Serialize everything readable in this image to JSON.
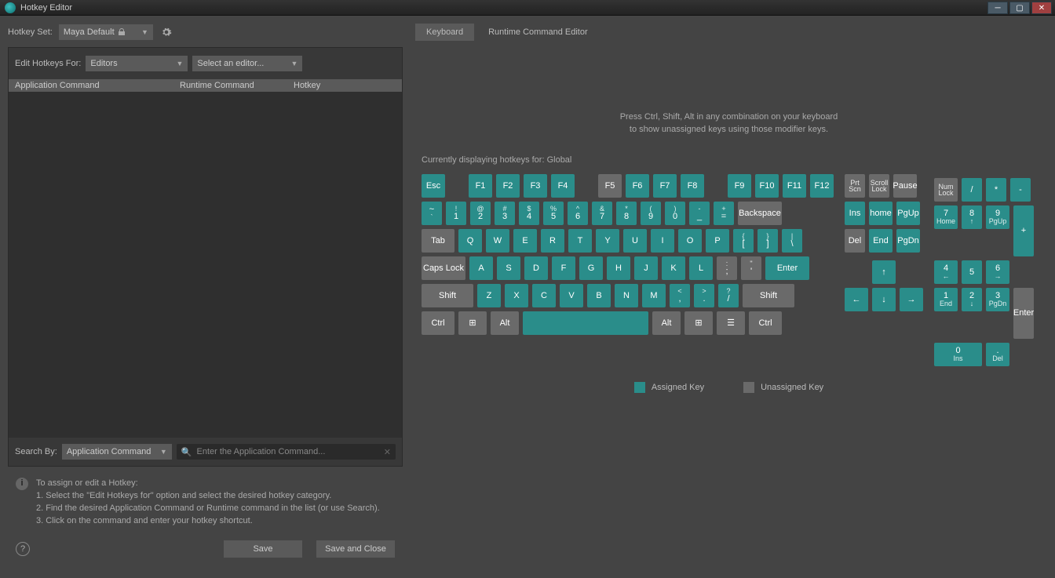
{
  "window": {
    "title": "Hotkey Editor"
  },
  "hotkeySet": {
    "label": "Hotkey Set:",
    "value": "Maya Default"
  },
  "editFor": {
    "label": "Edit Hotkeys For:",
    "value": "Editors",
    "editorValue": "Select an editor..."
  },
  "columns": {
    "appCmd": "Application Command",
    "rtCmd": "Runtime Command",
    "hotkey": "Hotkey"
  },
  "search": {
    "label": "Search By:",
    "mode": "Application Command",
    "placeholder": "Enter the Application Command..."
  },
  "help": {
    "title": "To assign or edit a Hotkey:",
    "l1": "1. Select the \"Edit Hotkeys for\" option and select the desired hotkey category.",
    "l2": "2. Find the desired Application Command or Runtime command in the list (or use Search).",
    "l3": "3. Click on the command and enter your hotkey shortcut."
  },
  "buttons": {
    "save": "Save",
    "saveClose": "Save and Close"
  },
  "tabs": {
    "keyboard": "Keyboard",
    "runtime": "Runtime Command Editor"
  },
  "hint": {
    "l1": "Press Ctrl, Shift, Alt in any combination on your keyboard",
    "l2": "to show unassigned keys using those modifier keys."
  },
  "contextLabel": "Currently displaying hotkeys for: Global",
  "legend": {
    "assigned": "Assigned Key",
    "unassigned": "Unassigned Key"
  },
  "keys": {
    "esc": "Esc",
    "f1": "F1",
    "f2": "F2",
    "f3": "F3",
    "f4": "F4",
    "f5": "F5",
    "f6": "F6",
    "f7": "F7",
    "f8": "F8",
    "f9": "F9",
    "f10": "F10",
    "f11": "F11",
    "f12": "F12",
    "tilde": "~",
    "backspace": "Backspace",
    "tab": "Tab",
    "caps": "Caps Lock",
    "enter": "Enter",
    "shift": "Shift",
    "ctrl": "Ctrl",
    "alt": "Alt",
    "prt": "Prt Scn",
    "scroll": "Scroll Lock",
    "pause": "Pause",
    "ins": "Ins",
    "home": "home",
    "pgup": "PgUp",
    "del": "Del",
    "end": "End",
    "pgdn": "PgDn",
    "up": "↑",
    "down": "↓",
    "left": "←",
    "right": "→",
    "numlock": "Num Lock",
    "slash": "/",
    "star": "*",
    "minus": "-",
    "plus": "+",
    "numenter": "Enter",
    "num0": "0",
    "num0s": "Ins",
    "num1": "1",
    "num1s": "End",
    "num2": "2",
    "num2s": "↓",
    "num3": "3",
    "num3s": "PgDn",
    "num4": "4",
    "num4s": "←",
    "num5": "5",
    "num6": "6",
    "num6s": "→",
    "num7": "7",
    "num7s": "Home",
    "num8": "8",
    "num8s": "↑",
    "num9": "9",
    "num9s": "PgUp",
    "dot": ".",
    "dots": "Del",
    "row2": [
      {
        "t": "!",
        "b": "1"
      },
      {
        "t": "@",
        "b": "2"
      },
      {
        "t": "#",
        "b": "3"
      },
      {
        "t": "$",
        "b": "4"
      },
      {
        "t": "%",
        "b": "5"
      },
      {
        "t": "^",
        "b": "6"
      },
      {
        "t": "&",
        "b": "7"
      },
      {
        "t": "*",
        "b": "8"
      },
      {
        "t": "(",
        "b": "9"
      },
      {
        "t": ")",
        "b": "0"
      },
      {
        "t": "-",
        "b": "_"
      },
      {
        "t": "+",
        "b": "="
      }
    ],
    "row3": [
      "Q",
      "W",
      "E",
      "R",
      "T",
      "Y",
      "U",
      "I",
      "O",
      "P"
    ],
    "row3b": [
      {
        "t": "{",
        "b": "["
      },
      {
        "t": "}",
        "b": "]"
      },
      {
        "t": "|",
        "b": "\\"
      }
    ],
    "row4": [
      "A",
      "S",
      "D",
      "F",
      "G",
      "H",
      "J",
      "K",
      "L"
    ],
    "row4b": [
      {
        "t": ":",
        "b": ";"
      },
      {
        "t": "\"",
        "b": "'"
      }
    ],
    "row5": [
      "Z",
      "X",
      "C",
      "V",
      "B",
      "N",
      "M"
    ],
    "row5b": [
      {
        "t": "<",
        "b": ","
      },
      {
        "t": ">",
        "b": "."
      },
      {
        "t": "?",
        "b": "/"
      }
    ]
  }
}
